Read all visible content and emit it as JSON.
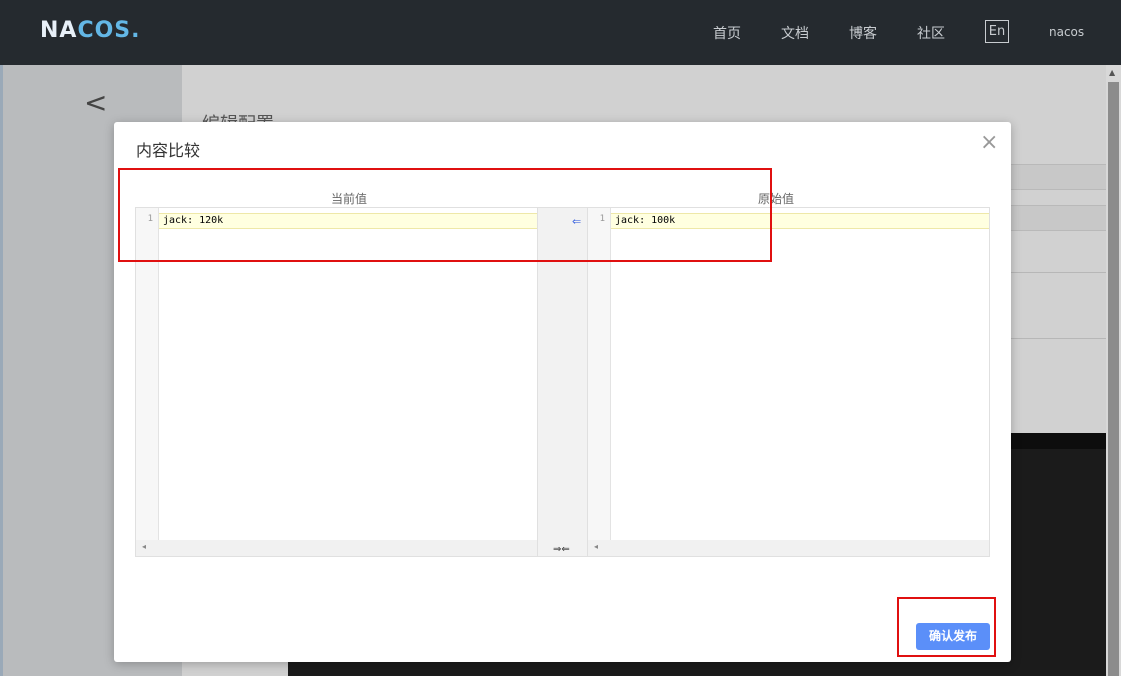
{
  "header": {
    "logo": {
      "part1": "NA",
      "part2": "COS",
      "suffix": "."
    },
    "nav": [
      "首页",
      "文档",
      "博客",
      "社区"
    ],
    "lang_toggle": "En",
    "user": "nacos"
  },
  "background_page": {
    "back_label": "<",
    "title": "编辑配置"
  },
  "modal": {
    "title": "内容比较",
    "close_label": "×",
    "left_header": "当前值",
    "right_header": "原始值",
    "left_editor": {
      "line_number": "1",
      "line_text": "jack: 120k"
    },
    "right_editor": {
      "line_number": "1",
      "line_text": "jack: 100k"
    },
    "gap_arrow": "⇐",
    "gap_bottom": "⇒⇐",
    "scroll_left": "◂",
    "confirm_label": "确认发布"
  },
  "colors": {
    "nav_bg": "#252a2f",
    "logo_accent": "#63b7e6",
    "primary_button": "#5b8ff9",
    "annotation": "#e01010",
    "diff_highlight": "#ffffe0"
  }
}
